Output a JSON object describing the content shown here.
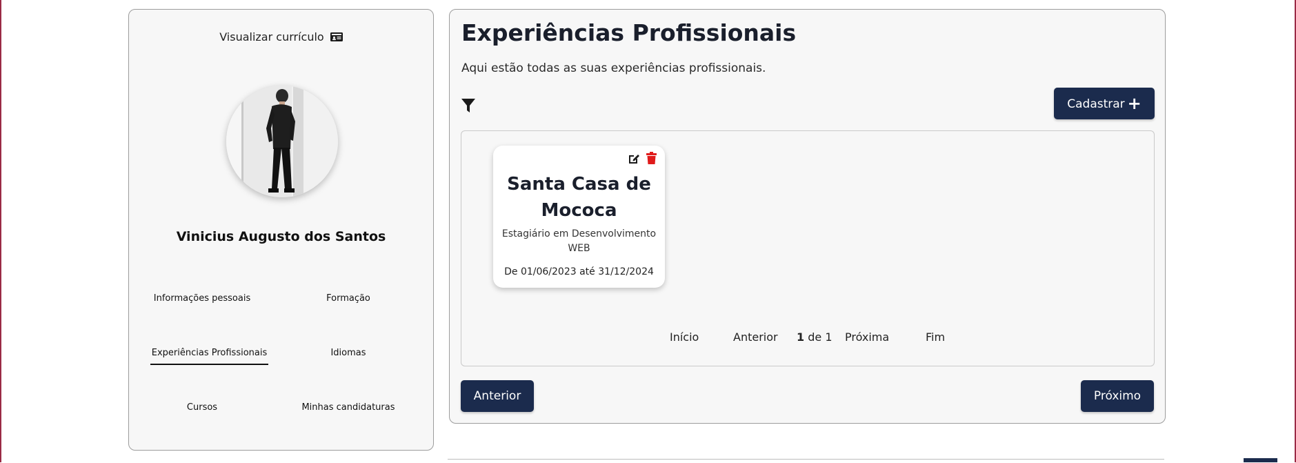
{
  "profile": {
    "view_cv_label": "Visualizar currículo",
    "view_cv_icon": "id-card-icon",
    "name": "Vinicius Augusto dos Santos",
    "nav": [
      {
        "label": "Informações pessoais",
        "active": false
      },
      {
        "label": "Formação",
        "active": false
      },
      {
        "label": "Experiências Profissionais",
        "active": true
      },
      {
        "label": "Idiomas",
        "active": false
      },
      {
        "label": "Cursos",
        "active": false
      },
      {
        "label": "Minhas candidaturas",
        "active": false
      }
    ]
  },
  "main": {
    "title": "Experiências Profissionais",
    "subtitle": "Aqui estão todas as suas experiências profissionais.",
    "filter_icon": "filter-icon",
    "register_label": "Cadastrar",
    "register_icon": "plus-icon",
    "experiences": [
      {
        "company": "Santa Casa de Mococa",
        "role": "Estagiário em Desenvolvimento WEB",
        "period": "De 01/06/2023 até 31/12/2024",
        "edit_icon": "edit-icon",
        "delete_icon": "trash-icon"
      }
    ],
    "pagination": {
      "first": "Início",
      "prev": "Anterior",
      "current": "1",
      "of_text": "de 1",
      "next": "Próxima",
      "last": "Fim"
    },
    "prev_button": "Anterior",
    "next_button": "Próximo"
  },
  "colors": {
    "primary": "#1b2b4d",
    "danger": "#e01b1b",
    "panel_bg": "#f7f7f7",
    "panel_border": "#9c9c9c"
  }
}
